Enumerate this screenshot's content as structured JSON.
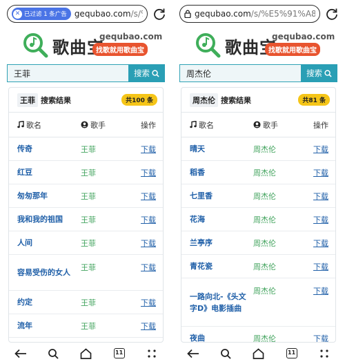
{
  "left": {
    "url": {
      "filter_badge": "已过滤 1 条广告",
      "domain": "gequbao.com",
      "path": "/s/%E7%"
    },
    "logo": {
      "name": "歌曲宝",
      "domain": "gequbao.com",
      "slogan": "找歌就用歌曲宝"
    },
    "search": {
      "value": "王菲",
      "button": "搜索"
    },
    "results": {
      "keyword": "王菲",
      "title": "搜索结果",
      "count": "共100 条",
      "headers": {
        "song": "歌名",
        "artist": "歌手",
        "op": "操作"
      },
      "rows": [
        {
          "song": "传奇",
          "artist": "王菲",
          "action": "下载"
        },
        {
          "song": "红豆",
          "artist": "王菲",
          "action": "下载"
        },
        {
          "song": "匆匆那年",
          "artist": "王菲",
          "action": "下载"
        },
        {
          "song": "我和我的祖国",
          "artist": "王菲",
          "action": "下载"
        },
        {
          "song": "人间",
          "artist": "王菲",
          "action": "下载"
        },
        {
          "song": "容易受伤的女人",
          "artist": "王菲",
          "action": "下载"
        },
        {
          "song": "约定",
          "artist": "王菲",
          "action": "下载"
        },
        {
          "song": "流年",
          "artist": "王菲",
          "action": "下载"
        }
      ]
    },
    "nav": {
      "tabs_count": "11"
    }
  },
  "right": {
    "url": {
      "domain": "gequbao.com",
      "path": "/s/%E5%91%A8%E6%9"
    },
    "logo": {
      "name": "歌曲宝",
      "domain": "gequbao.com",
      "slogan": "找歌就用歌曲宝"
    },
    "search": {
      "value": "周杰伦",
      "button": "搜索"
    },
    "results": {
      "keyword": "周杰伦",
      "title": "搜索结果",
      "count": "共81 条",
      "headers": {
        "song": "歌名",
        "artist": "歌手",
        "op": "操作"
      },
      "rows": [
        {
          "song": "晴天",
          "artist": "周杰伦",
          "action": "下载"
        },
        {
          "song": "稻香",
          "artist": "周杰伦",
          "action": "下载"
        },
        {
          "song": "七里香",
          "artist": "周杰伦",
          "action": "下载"
        },
        {
          "song": "花海",
          "artist": "周杰伦",
          "action": "下载"
        },
        {
          "song": "兰亭序",
          "artist": "周杰伦",
          "action": "下载"
        },
        {
          "song": "青花瓷",
          "artist": "周杰伦",
          "action": "下载"
        },
        {
          "song": "一路向北-《头文字D》电影插曲",
          "artist": "周杰伦",
          "action": "下载"
        },
        {
          "song": "夜曲",
          "artist": "周杰伦",
          "action": "下载"
        }
      ]
    },
    "nav": {
      "tabs_count": "11"
    }
  },
  "colors": {
    "accent": "#2a9fb5",
    "link": "#1f5fa8",
    "artist": "#3fa25b",
    "slogan_bg": "#e8542f",
    "count_badge": "#f5c518",
    "filter_pill": "#4a74e6"
  }
}
